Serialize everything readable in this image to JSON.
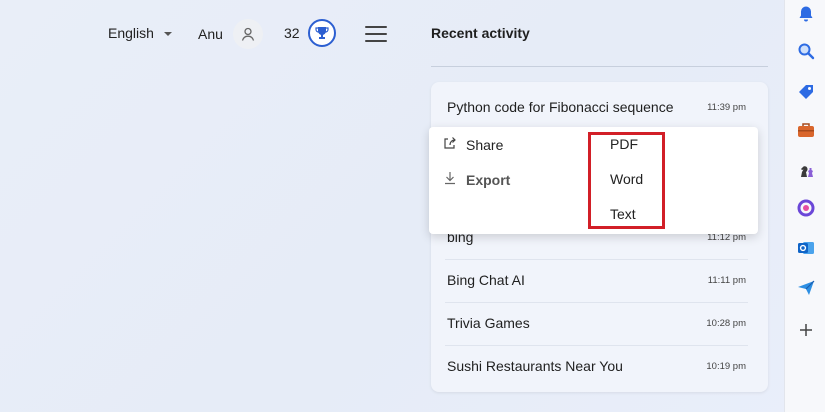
{
  "header": {
    "language": "English",
    "user_name": "Anu",
    "points": "32",
    "recent_activity_title": "Recent activity"
  },
  "activity": [
    {
      "title": "Python code for Fibonacci sequence",
      "time": "11:39 pm"
    },
    {
      "title": "bing",
      "time": "11:12 pm"
    },
    {
      "title": "Bing Chat AI",
      "time": "11:11 pm"
    },
    {
      "title": "Trivia Games",
      "time": "10:28 pm"
    },
    {
      "title": "Sushi Restaurants Near You",
      "time": "10:19 pm"
    }
  ],
  "context_menu": {
    "share_label": "Share",
    "export_label": "Export",
    "export_options": [
      "PDF",
      "Word",
      "Text"
    ],
    "highlight_color": "#d21f27"
  },
  "sidebar_icons": [
    "bell-icon",
    "search-icon",
    "tag-icon",
    "briefcase-icon",
    "chess-icon",
    "office-icon",
    "outlook-icon",
    "send-icon",
    "plus-icon"
  ],
  "colors": {
    "accent": "#2c5fd1",
    "background": "#e7ecf7"
  }
}
